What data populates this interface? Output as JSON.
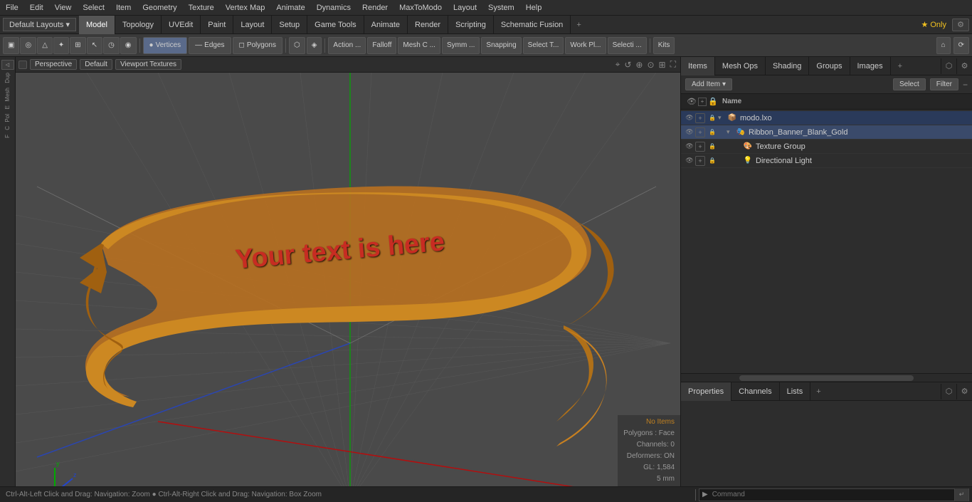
{
  "menu": {
    "items": [
      "File",
      "Edit",
      "View",
      "Select",
      "Item",
      "Geometry",
      "Texture",
      "Vertex Map",
      "Animate",
      "Dynamics",
      "Render",
      "MaxToModo",
      "Layout",
      "System",
      "Help"
    ]
  },
  "layout_bar": {
    "default_layouts": "Default Layouts ▾",
    "tabs": [
      "Model",
      "Topology",
      "UVEdit",
      "Paint",
      "Layout",
      "Setup",
      "Game Tools",
      "Animate",
      "Render",
      "Scripting",
      "Schematic Fusion"
    ],
    "active_tab": "Model",
    "star_label": "★ Only",
    "add_btn": "+"
  },
  "toolbar": {
    "left_group": [
      "▣",
      "◎",
      "△",
      "✦",
      "⊞",
      "⊡",
      "◷",
      "◉"
    ],
    "component_btns": [
      "Vertices",
      "Edges",
      "Polygons"
    ],
    "right_group_1": [
      "Action ...",
      "Falloff",
      "Mesh C ...",
      "Symm ...",
      "Snapping",
      "Select T...",
      "Work Pl...",
      "Selecti ..."
    ],
    "kits_btn": "Kits"
  },
  "viewport": {
    "perspective_btn": "Perspective",
    "default_btn": "Default",
    "viewport_textures": "Viewport Textures",
    "status": {
      "no_items": "No Items",
      "polygons": "Polygons : Face",
      "channels": "Channels: 0",
      "deformers": "Deformers: ON",
      "gl": "GL: 1,584",
      "units": "5 mm"
    },
    "bottom_status": "Ctrl-Alt-Left Click and Drag: Navigation: Zoom  ●  Ctrl-Alt-Right Click and Drag: Navigation: Box Zoom"
  },
  "right_panel": {
    "tabs": [
      "Items",
      "Mesh Ops",
      "Shading",
      "Groups",
      "Images"
    ],
    "active_tab": "Items",
    "add_item_label": "Add Item",
    "add_item_arrow": "▾",
    "select_label": "Select",
    "filter_label": "Filter",
    "col_header": "Name",
    "tree": [
      {
        "id": 1,
        "indent": 0,
        "expand": "▾",
        "icon": "📦",
        "label": "modo.lxo",
        "type": "root",
        "selected": true
      },
      {
        "id": 2,
        "indent": 1,
        "expand": "▾",
        "icon": "🎭",
        "label": "Ribbon_Banner_Blank_Gold",
        "type": "mesh"
      },
      {
        "id": 3,
        "indent": 2,
        "expand": "",
        "icon": "🎨",
        "label": "Texture Group",
        "type": "texture"
      },
      {
        "id": 4,
        "indent": 2,
        "expand": "",
        "icon": "💡",
        "label": "Directional Light",
        "type": "light"
      }
    ]
  },
  "properties_panel": {
    "tabs": [
      "Properties",
      "Channels",
      "Lists"
    ],
    "active_tab": "Properties",
    "add_btn": "+"
  },
  "cmd_bar": {
    "status_text": "Ctrl-Alt-Left Click and Drag: Navigation: Zoom  ●  Ctrl-Alt-Right Click and Drag: Navigation: Box Zoom",
    "arrow": "▶",
    "input_placeholder": "Command",
    "go_btn": "↵"
  }
}
